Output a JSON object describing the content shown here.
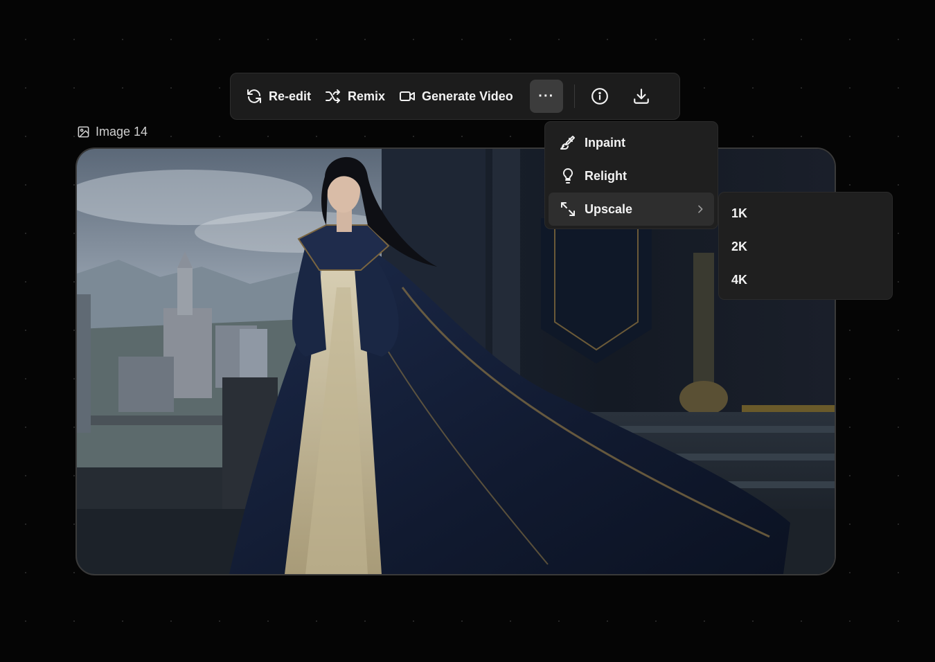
{
  "toolbar": {
    "reedit_label": "Re-edit",
    "remix_label": "Remix",
    "generate_video_label": "Generate Video",
    "more_label": "···",
    "icons": {
      "reedit": "refresh-icon",
      "remix": "shuffle-icon",
      "generate_video": "video-camera-icon",
      "more": "more-dots-icon",
      "info": "info-icon",
      "download": "download-icon"
    }
  },
  "image": {
    "label": "Image 14",
    "label_icon": "image-icon"
  },
  "menu": {
    "items": [
      {
        "label": "Inpaint",
        "icon": "brush-icon"
      },
      {
        "label": "Relight",
        "icon": "lightbulb-icon"
      },
      {
        "label": "Upscale",
        "icon": "expand-arrows-icon",
        "has_submenu": true
      }
    ]
  },
  "submenu": {
    "items": [
      "1K",
      "2K",
      "4K"
    ]
  },
  "colors": {
    "background": "#050505",
    "panel": "#1c1c1c",
    "menu": "#1f1f1f",
    "active": "#2e2e2e",
    "text": "#f2f2f2"
  }
}
